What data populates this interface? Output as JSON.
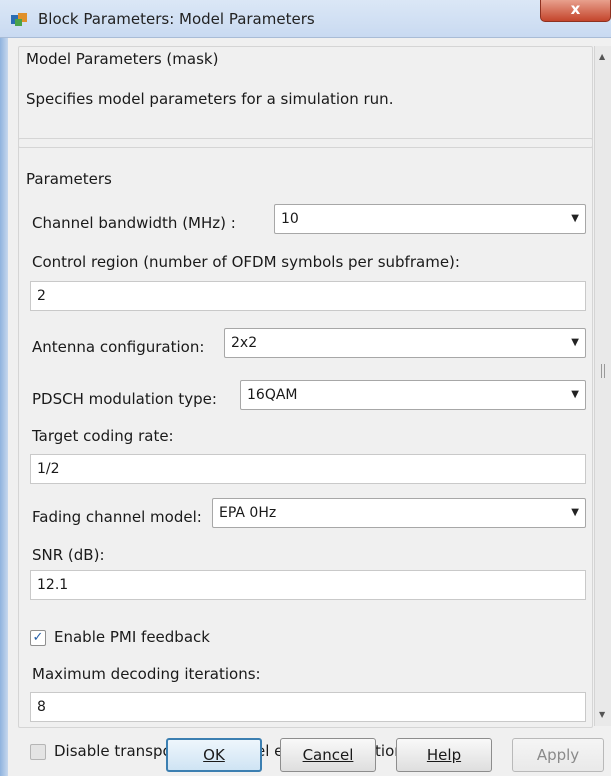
{
  "window": {
    "title": "Block Parameters: Model Parameters",
    "close_glyph": "x"
  },
  "mask": {
    "title": "Model Parameters (mask)",
    "description": "Specifies model parameters for a simulation run."
  },
  "parameters": {
    "heading": "Parameters",
    "channel_bandwidth": {
      "label": "Channel bandwidth (MHz) :",
      "value": "10"
    },
    "control_region": {
      "label": "Control region (number of OFDM symbols per subframe):",
      "value": "2"
    },
    "antenna_configuration": {
      "label": "Antenna configuration:",
      "value": "2x2"
    },
    "pdsch_modulation": {
      "label": "PDSCH modulation type:",
      "value": "16QAM"
    },
    "target_coding_rate": {
      "label": "Target coding rate:",
      "value": "1/2"
    },
    "fading_channel_model": {
      "label": "Fading channel model:",
      "value": "EPA 0Hz"
    },
    "snr": {
      "label": "SNR (dB):",
      "value": "12.1"
    },
    "enable_pmi": {
      "label": "Enable PMI feedback",
      "checked": true
    },
    "max_decoding_iterations": {
      "label": "Maximum decoding iterations:",
      "value": "8"
    },
    "disable_early_termination": {
      "label": "Disable transport-block level early termination",
      "checked": false
    }
  },
  "buttons": {
    "ok": "OK",
    "cancel": "Cancel",
    "help": "Help",
    "apply": "Apply"
  },
  "icons": {
    "dropdown": "chevron-down-icon",
    "check": "checkmark-icon",
    "app": "simulink-block-icon"
  },
  "colors": {
    "accent": "#3c7fb1",
    "titlebar": "#c9daf1",
    "close": "#c4452c"
  }
}
